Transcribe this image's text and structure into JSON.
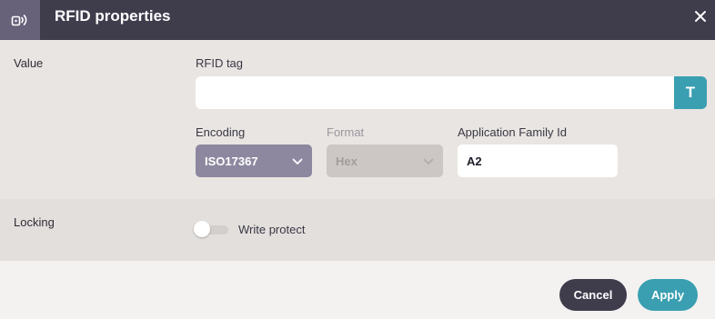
{
  "header": {
    "title": "RFID properties",
    "icon": "rfid-icon",
    "close_icon": "close-icon",
    "bg_color": "#3f3c4c",
    "icon_box_color": "#676179"
  },
  "value_section": {
    "label": "Value",
    "rfid_tag": {
      "label": "RFID tag",
      "value": "",
      "button_label": "T"
    },
    "encoding": {
      "label": "Encoding",
      "selected": "ISO17367"
    },
    "format": {
      "label": "Format",
      "selected": "Hex",
      "disabled": true
    },
    "application_family_id": {
      "label": "Application Family Id",
      "value": "A2"
    }
  },
  "locking_section": {
    "label": "Locking",
    "write_protect": {
      "label": "Write protect",
      "checked": false
    }
  },
  "footer": {
    "cancel_label": "Cancel",
    "apply_label": "Apply"
  },
  "colors": {
    "accent": "#3a9fb1",
    "dark": "#3f3c4c"
  }
}
